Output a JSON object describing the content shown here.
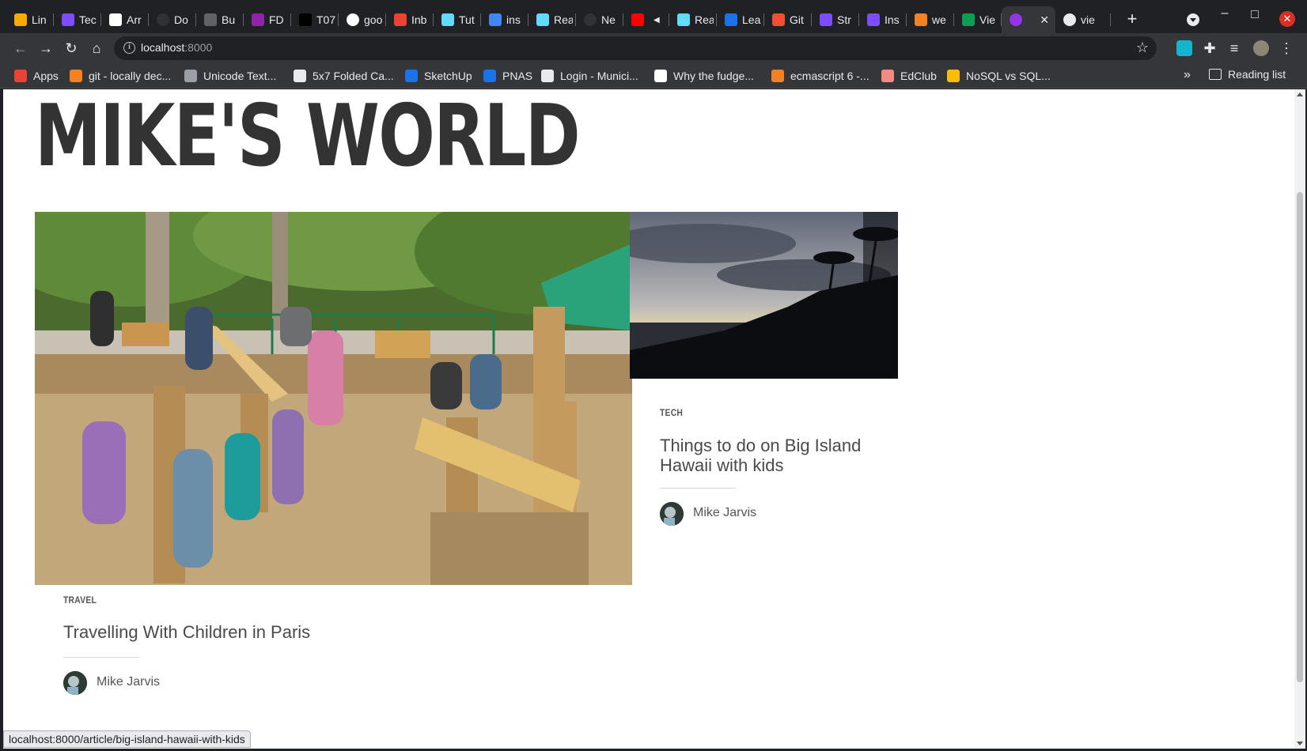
{
  "browser": {
    "tabs": [
      {
        "label": "Lin",
        "icon": "bolt-icon",
        "color": "#f9ab00"
      },
      {
        "label": "Tec",
        "icon": "tech-icon",
        "color": "#7c4dff"
      },
      {
        "label": "Arr",
        "icon": "graduation-cap-icon",
        "color": "#ffffff"
      },
      {
        "label": "Do",
        "icon": "dark-circle-icon",
        "color": "#303134"
      },
      {
        "label": "Bu",
        "icon": "gear-icon",
        "color": "#5f6368"
      },
      {
        "label": "FD",
        "icon": "hex-icon",
        "color": "#8e24aa"
      },
      {
        "label": "T07",
        "icon": "square-icon",
        "color": "#000000"
      },
      {
        "label": "goo",
        "icon": "google-icon",
        "color": "#ffffff"
      },
      {
        "label": "Inb",
        "icon": "gmail-icon",
        "color": "#ea4335"
      },
      {
        "label": "Tut",
        "icon": "react-icon",
        "color": "#61dafb"
      },
      {
        "label": "ins",
        "icon": "app-icon",
        "color": "#4285f4"
      },
      {
        "label": "Rea",
        "icon": "react-icon",
        "color": "#61dafb"
      },
      {
        "label": "Ne",
        "icon": "dark-circle-icon",
        "color": "#303134"
      },
      {
        "label": "",
        "icon": "youtube-icon",
        "color": "#ff0000"
      },
      {
        "label": "Rea",
        "icon": "react-icon",
        "color": "#61dafb"
      },
      {
        "label": "Lea",
        "icon": "square-icon",
        "color": "#1a73e8"
      },
      {
        "label": "Git",
        "icon": "git-icon",
        "color": "#f05032"
      },
      {
        "label": "Str",
        "icon": "flag-icon",
        "color": "#7c4dff"
      },
      {
        "label": "Ins",
        "icon": "flag-icon",
        "color": "#7c4dff"
      },
      {
        "label": "we",
        "icon": "stackoverflow-icon",
        "color": "#f48024"
      },
      {
        "label": "Vie",
        "icon": "vue-icon",
        "color": "#0f9d58"
      },
      {
        "label": "",
        "icon": "purple-circle-icon",
        "color": "#9334e6",
        "active": true
      },
      {
        "label": "vie",
        "icon": "globe-icon",
        "color": "#e8eaed"
      }
    ],
    "close_tab": "✕",
    "new_tab": "+",
    "url_host": "localhost",
    "url_port": ":8000",
    "bookmarks": [
      {
        "label": "Apps",
        "color": "#ea4335"
      },
      {
        "label": "git - locally dec...",
        "color": "#f48024"
      },
      {
        "label": "Unicode Text...",
        "color": "#9aa0a6"
      },
      {
        "label": "5x7 Folded Ca...",
        "color": "#e8eaed"
      },
      {
        "label": "SketchUp",
        "color": "#1a73e8"
      },
      {
        "label": "PNAS",
        "color": "#1a73e8"
      },
      {
        "label": "Login - Munici...",
        "color": "#e8eaed"
      },
      {
        "label": "Why the fudge...",
        "color": "#ffffff"
      },
      {
        "label": "ecmascript 6 -...",
        "color": "#f48024"
      },
      {
        "label": "EdClub",
        "color": "#f28b82"
      },
      {
        "label": "NoSQL vs SQL...",
        "color": "#fbbc04"
      }
    ],
    "more_bookmarks": "»",
    "reading_list": "Reading list",
    "status_url": "localhost:8000/article/big-island-hawaii-with-kids"
  },
  "site": {
    "title": "MIKE'S WORLD",
    "articles": [
      {
        "category": "TRAVEL",
        "title": "Travelling With Children in Paris",
        "author": "Mike Jarvis"
      },
      {
        "category": "TECH",
        "title": "Things to do on Big Island Hawaii with kids",
        "author": "Mike Jarvis"
      }
    ]
  }
}
